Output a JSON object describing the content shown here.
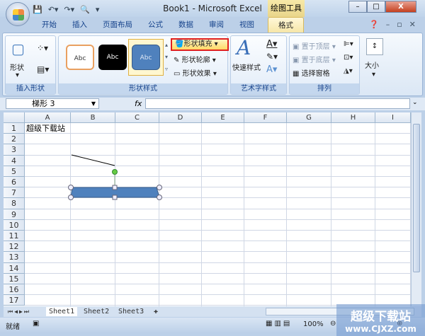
{
  "window": {
    "title": "Book1 - Microsoft Excel",
    "context_tab": "绘图工具"
  },
  "tabs": [
    "开始",
    "插入",
    "页面布局",
    "公式",
    "数据",
    "审阅",
    "视图",
    "格式"
  ],
  "ribbon": {
    "insert_shapes": {
      "shapes_label": "形状",
      "group_label": "插入形状"
    },
    "shape_styles": {
      "swatch_text": "Abc",
      "fill": "形状填充",
      "outline": "形状轮廓",
      "effects": "形状效果",
      "group_label": "形状样式"
    },
    "wordart": {
      "quick_styles": "快速样式",
      "group_label": "艺术字样式"
    },
    "arrange": {
      "bring_front": "置于顶层",
      "send_back": "置于底层",
      "selection_pane": "选择窗格",
      "group_label": "排列"
    },
    "size": {
      "label": "大小"
    }
  },
  "formula_bar": {
    "name_box": "梯形 3",
    "fx": "fx",
    "value": ""
  },
  "columns": [
    "A",
    "B",
    "C",
    "D",
    "E",
    "F",
    "G",
    "H",
    "I"
  ],
  "rows": [
    "1",
    "2",
    "3",
    "4",
    "5",
    "6",
    "7",
    "8",
    "9",
    "10",
    "11",
    "12",
    "13",
    "14",
    "15",
    "16",
    "17"
  ],
  "cells": {
    "A1": "超级下载站"
  },
  "sheets": [
    "Sheet1",
    "Sheet2",
    "Sheet3"
  ],
  "status": {
    "text": "就绪",
    "zoom": "100%"
  },
  "watermark": {
    "title": "超级下载站",
    "url": "www.CJXZ.com"
  },
  "colors": {
    "shape_fill": "#4f81bd",
    "highlight": "#e02020"
  }
}
